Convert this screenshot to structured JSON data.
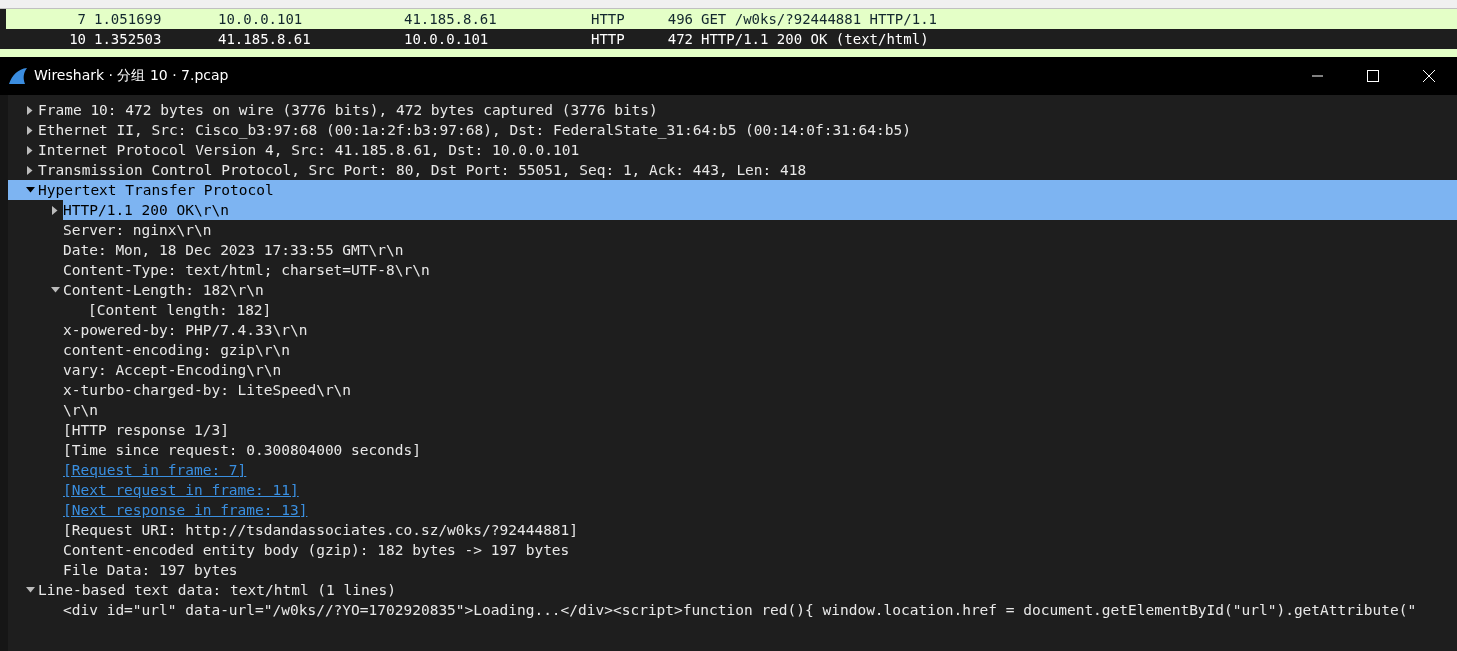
{
  "packet_list": {
    "rows": [
      {
        "no": "7",
        "time": "1.051699",
        "source": "10.0.0.101",
        "destination": "41.185.8.61",
        "protocol": "HTTP",
        "length": "496",
        "info": "GET /w0ks/?92444881 HTTP/1.1",
        "selected": false
      },
      {
        "no": "10",
        "time": "1.352503",
        "source": "41.185.8.61",
        "destination": "10.0.0.101",
        "protocol": "HTTP",
        "length": "472",
        "info": "HTTP/1.1 200 OK  (text/html)",
        "selected": true
      }
    ]
  },
  "window": {
    "title": "Wireshark · 分组 10 · 7.pcap"
  },
  "tree": [
    {
      "label": "Frame 10: 472 bytes on wire (3776 bits), 472 bytes captured (3776 bits)",
      "expanded": false,
      "selected": false
    },
    {
      "label": "Ethernet II, Src: Cisco_b3:97:68 (00:1a:2f:b3:97:68), Dst: FederalState_31:64:b5 (00:14:0f:31:64:b5)",
      "expanded": false,
      "selected": false
    },
    {
      "label": "Internet Protocol Version 4, Src: 41.185.8.61, Dst: 10.0.0.101",
      "expanded": false,
      "selected": false
    },
    {
      "label": "Transmission Control Protocol, Src Port: 80, Dst Port: 55051, Seq: 1, Ack: 443, Len: 418",
      "expanded": false,
      "selected": false
    },
    {
      "label": "Hypertext Transfer Protocol",
      "expanded": true,
      "selected": true,
      "children": [
        {
          "label": "HTTP/1.1 200 OK\\r\\n",
          "expanded": false,
          "selected": true
        },
        {
          "label": "Server: nginx\\r\\n",
          "selected": false
        },
        {
          "label": "Date: Mon, 18 Dec 2023 17:33:55 GMT\\r\\n",
          "selected": false
        },
        {
          "label": "Content-Type: text/html; charset=UTF-8\\r\\n",
          "selected": false
        },
        {
          "label": "Content-Length: 182\\r\\n",
          "expanded": true,
          "selected": false,
          "children": [
            {
              "label": "[Content length: 182]",
              "selected": false
            }
          ]
        },
        {
          "label": "x-powered-by: PHP/7.4.33\\r\\n",
          "selected": false
        },
        {
          "label": "content-encoding: gzip\\r\\n",
          "selected": false
        },
        {
          "label": "vary: Accept-Encoding\\r\\n",
          "selected": false
        },
        {
          "label": "x-turbo-charged-by: LiteSpeed\\r\\n",
          "selected": false
        },
        {
          "label": "\\r\\n",
          "selected": false
        },
        {
          "label": "[HTTP response 1/3]",
          "selected": false
        },
        {
          "label": "[Time since request: 0.300804000 seconds]",
          "selected": false
        },
        {
          "label": "[Request in frame: 7]",
          "kind": "link",
          "selected": false
        },
        {
          "label": "[Next request in frame: 11]",
          "kind": "link",
          "selected": false
        },
        {
          "label": "[Next response in frame: 13]",
          "kind": "link",
          "selected": false
        },
        {
          "label": "[Request URI: http://tsdandassociates.co.sz/w0ks/?92444881]",
          "selected": false
        },
        {
          "label": "Content-encoded entity body (gzip): 182 bytes -> 197 bytes",
          "selected": false
        },
        {
          "label": "File Data: 197 bytes",
          "selected": false
        }
      ]
    },
    {
      "label": "Line-based text data: text/html (1 lines)",
      "expanded": true,
      "selected": false,
      "children": [
        {
          "label": "<div id=\"url\" data-url=\"/w0ks//?YO=1702920835\">Loading...</div><script>function red(){ window.location.href = document.getElementById(\"url\").getAttribute(\"",
          "selected": false
        }
      ]
    }
  ]
}
